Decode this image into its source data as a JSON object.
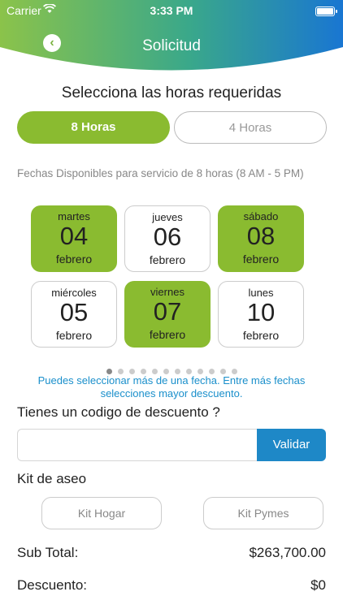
{
  "status_bar": {
    "carrier": "Carrier",
    "time": "3:33 PM"
  },
  "header": {
    "title": "Solicitud",
    "gradient_start": "#8bc34a",
    "gradient_end": "#1976d2"
  },
  "heading": "Selecciona las horas requeridas",
  "hours": {
    "selected": "8 Horas",
    "other": "4 Horas"
  },
  "availability_text": "Fechas Disponibles para servicio de 8 horas  (8 AM - 5 PM)",
  "dates": [
    {
      "day": "martes",
      "num": "04",
      "month": "febrero",
      "selected": true
    },
    {
      "day": "jueves",
      "num": "06",
      "month": "febrero",
      "selected": false
    },
    {
      "day": "sábado",
      "num": "08",
      "month": "febrero",
      "selected": true
    },
    {
      "day": "miércoles",
      "num": "05",
      "month": "febrero",
      "selected": false
    },
    {
      "day": "viernes",
      "num": "07",
      "month": "febrero",
      "selected": true
    },
    {
      "day": "lunes",
      "num": "10",
      "month": "febrero",
      "selected": false
    }
  ],
  "pagination": {
    "current": 1,
    "total": 12
  },
  "hint": "Puedes seleccionar más de una fecha. Entre más fechas selecciones mayor descuento.",
  "discount": {
    "label": "Tienes un codigo de descuento ?",
    "input_value": "",
    "placeholder": "",
    "button": "Validar"
  },
  "kit": {
    "label": "Kit de aseo",
    "options": [
      "Kit Hogar",
      "Kit Pymes"
    ]
  },
  "summary": {
    "subtotal_label": "Sub Total:",
    "subtotal_value": "$263,700.00",
    "discount_label": "Descuento:",
    "discount_value": "$0"
  },
  "colors": {
    "accent_green": "#8abb30",
    "accent_blue": "#1e88c7",
    "hint_blue": "#1a8fcb"
  }
}
